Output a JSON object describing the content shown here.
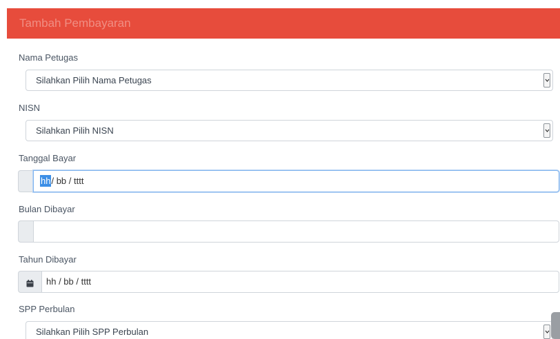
{
  "header": {
    "title": "Tambah Pembayaran",
    "color": "#e74c3c"
  },
  "form": {
    "nama_petugas": {
      "label": "Nama Petugas",
      "selected": "Silahkan Pilih Nama Petugas"
    },
    "nisn": {
      "label": "NISN",
      "selected": "Silahkan Pilih NISN"
    },
    "tanggal_bayar": {
      "label": "Tanggal Bayar",
      "seg_day": "hh",
      "seg_rest": "/ bb / tttt"
    },
    "bulan_dibayar": {
      "label": "Bulan Dibayar",
      "value": ""
    },
    "tahun_dibayar": {
      "label": "Tahun Dibayar",
      "icon": "calendar-icon",
      "value": "hh / bb / tttt"
    },
    "spp_perbulan": {
      "label": "SPP Perbulan",
      "selected": "Silahkan Pilih SPP Perbulan"
    }
  }
}
